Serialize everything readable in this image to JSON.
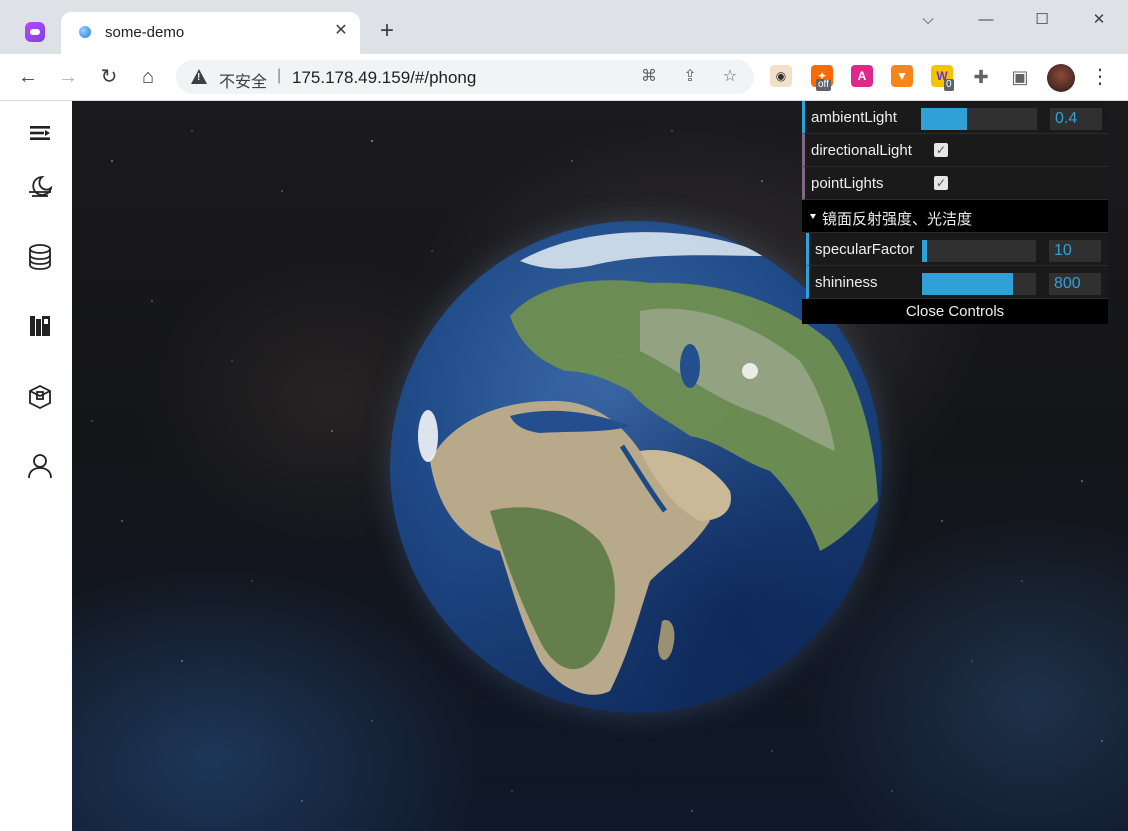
{
  "browser": {
    "tab_title": "some-demo",
    "security_label": "不安全",
    "url": "175.178.49.159/#/phong",
    "extensions": [
      {
        "name": "owl-extension-icon"
      },
      {
        "name": "adblock-extension-icon",
        "badge": "off"
      },
      {
        "name": "translate-extension-icon"
      },
      {
        "name": "metamask-extension-icon"
      },
      {
        "name": "wallet-extension-icon",
        "badge": "0"
      }
    ]
  },
  "sidebar": {
    "items": [
      "menu-toggle",
      "moon-scene",
      "database",
      "library",
      "package",
      "user"
    ]
  },
  "controls": {
    "ambient": {
      "label": "ambientLight",
      "value": "0.4",
      "fraction": 0.4
    },
    "directional": {
      "label": "directionalLight",
      "checked": true
    },
    "point": {
      "label": "pointLights",
      "checked": true
    },
    "folder": {
      "title": "镜面反射强度、光洁度",
      "specular": {
        "label": "specularFactor",
        "value": "10",
        "fraction": 0.04
      },
      "shininess": {
        "label": "shininess",
        "value": "800",
        "fraction": 0.8
      }
    },
    "close_label": "Close Controls"
  },
  "colors": {
    "accent": "#2fa1d6",
    "panel_bg": "#1a1a1a",
    "boolean_accent": "#806787"
  }
}
